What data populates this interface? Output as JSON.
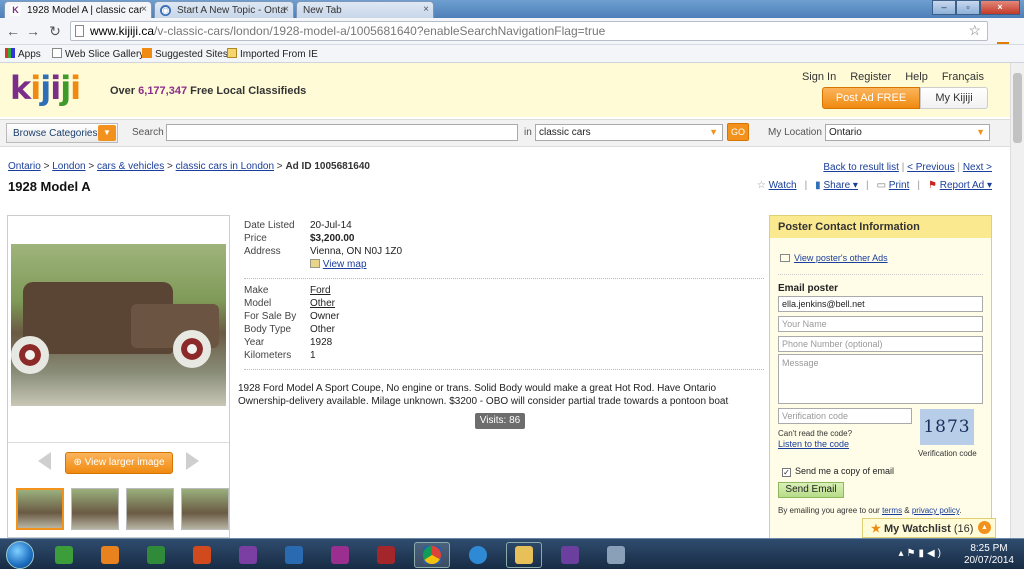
{
  "browser": {
    "tabs": [
      {
        "label": "1928 Model A | classic car",
        "fav": "K"
      },
      {
        "label": "Start A New Topic - Onta",
        "fav": "◉"
      },
      {
        "label": "New Tab",
        "fav": ""
      }
    ],
    "url_host": "www.kijiji.ca",
    "url_path": "/v-classic-cars/london/1928-model-a/1005681640?enableSearchNavigationFlag=true",
    "bookmarks": [
      "Apps",
      "Web Slice Gallery",
      "Suggested Sites",
      "Imported From IE"
    ]
  },
  "site": {
    "logo": "kijiji",
    "tagline_pre": "Over ",
    "tagline_num": "6,177,347",
    "tagline_post": " Free Local Classifieds",
    "toplinks": [
      "Sign In",
      "Register",
      "Help",
      "Français"
    ],
    "post_ad": "Post Ad FREE",
    "my_kijiji": "My Kijiji"
  },
  "searchbar": {
    "browse": "Browse Categories",
    "search_label": "Search",
    "in_label": "in",
    "category": "classic cars",
    "go": "GO",
    "location_label": "My Location",
    "location": "Ontario"
  },
  "breadcrumb": {
    "items": [
      "Ontario",
      "London",
      "cars & vehicles",
      "classic cars in London"
    ],
    "ad_id": "Ad ID 1005681640",
    "seps": " > "
  },
  "pager": {
    "back": "Back to result list",
    "prev": "< Previous",
    "next": "Next >"
  },
  "title": "1928 Model A",
  "actions": {
    "watch": "Watch",
    "share": "Share ▾",
    "print": "Print",
    "report": "Report Ad ▾"
  },
  "images": {
    "larger": "View larger image"
  },
  "details": {
    "top": [
      {
        "k": "Date Listed",
        "v": "20-Jul-14"
      },
      {
        "k": "Price",
        "v": "$3,200.00"
      },
      {
        "k": "Address",
        "v": "Vienna, ON N0J 1Z0"
      }
    ],
    "view_map": "View map",
    "attrs": [
      {
        "k": "Make",
        "v": "Ford"
      },
      {
        "k": "Model",
        "v": "Other"
      },
      {
        "k": "For Sale By",
        "v": "Owner"
      },
      {
        "k": "Body Type",
        "v": "Other"
      },
      {
        "k": "Year",
        "v": "1928"
      },
      {
        "k": "Kilometers",
        "v": "1"
      }
    ]
  },
  "description": "1928 Ford Model A Sport Coupe, No engine or trans. Solid Body would make a great Hot Rod. Have Ontario Ownership-delivery available. Milage unknown. $3200 - OBO will consider partial trade towards a pontoon boat",
  "visits": "Visits: 86",
  "contact": {
    "header": "Poster Contact Information",
    "other_ads": "View poster's other Ads",
    "email_poster": "Email poster",
    "email_value": "ella.jenkins@bell.net",
    "name_ph": "Your Name",
    "phone_ph": "Phone Number (optional)",
    "message_ph": "Message",
    "verif_ph": "Verification code",
    "captcha": "1873",
    "cant_read": "Can't read the code?",
    "listen": "Listen to the code",
    "verif_label": "Verification code",
    "send_copy": "Send me a copy of email",
    "send": "Send Email",
    "terms_pre": "By emailing you agree to our ",
    "terms": "terms",
    "and": " & ",
    "privacy": "privacy policy",
    "dot": "."
  },
  "watchlist": {
    "label": "My Watchlist",
    "count": "(16)"
  },
  "taskbar": {
    "time": "8:25 PM",
    "date": "20/07/2014"
  }
}
